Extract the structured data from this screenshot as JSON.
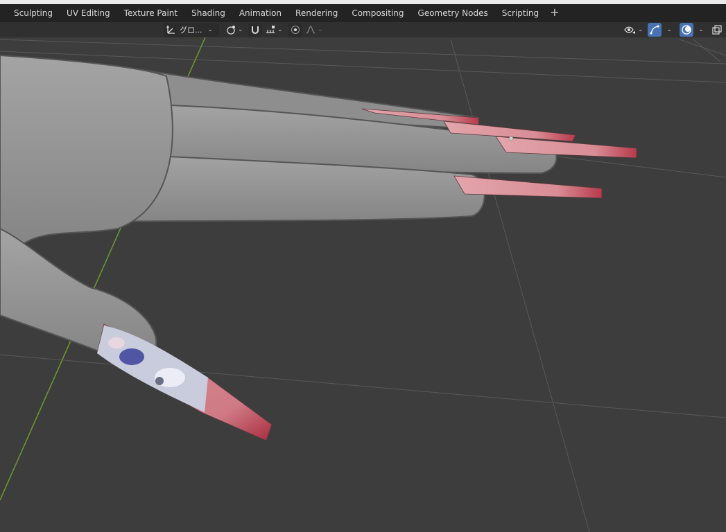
{
  "workspace_tabs": [
    "Sculpting",
    "UV Editing",
    "Texture Paint",
    "Shading",
    "Animation",
    "Rendering",
    "Compositing",
    "Geometry Nodes",
    "Scripting"
  ],
  "add_tab_label": "+",
  "header": {
    "transform_orientation_label": "グロ...",
    "transform_orientation_icon": "transform-orientation-icon",
    "pivot_icon": "pivot-point-icon",
    "snap_icon": "snap-magnet-icon",
    "snap_target_icon": "snap-increment-icon",
    "proportional_icon": "proportional-edit-icon",
    "falloff_icon": "falloff-curve-icon",
    "visibility_icon": "eye-visibility-icon",
    "gizmo_icon": "gizmo-icon",
    "overlay_icon": "overlay-icon",
    "xray_icon": "xray-icon"
  },
  "colors": {
    "viewport_bg": "#3d3d3d",
    "grid": "#5a5a5a",
    "y_axis": "#6e9a2e",
    "skin": "#9a9a9a",
    "nail": "#d98f97",
    "nail_tip": "#b8394a",
    "active_button": "#4772b3"
  }
}
